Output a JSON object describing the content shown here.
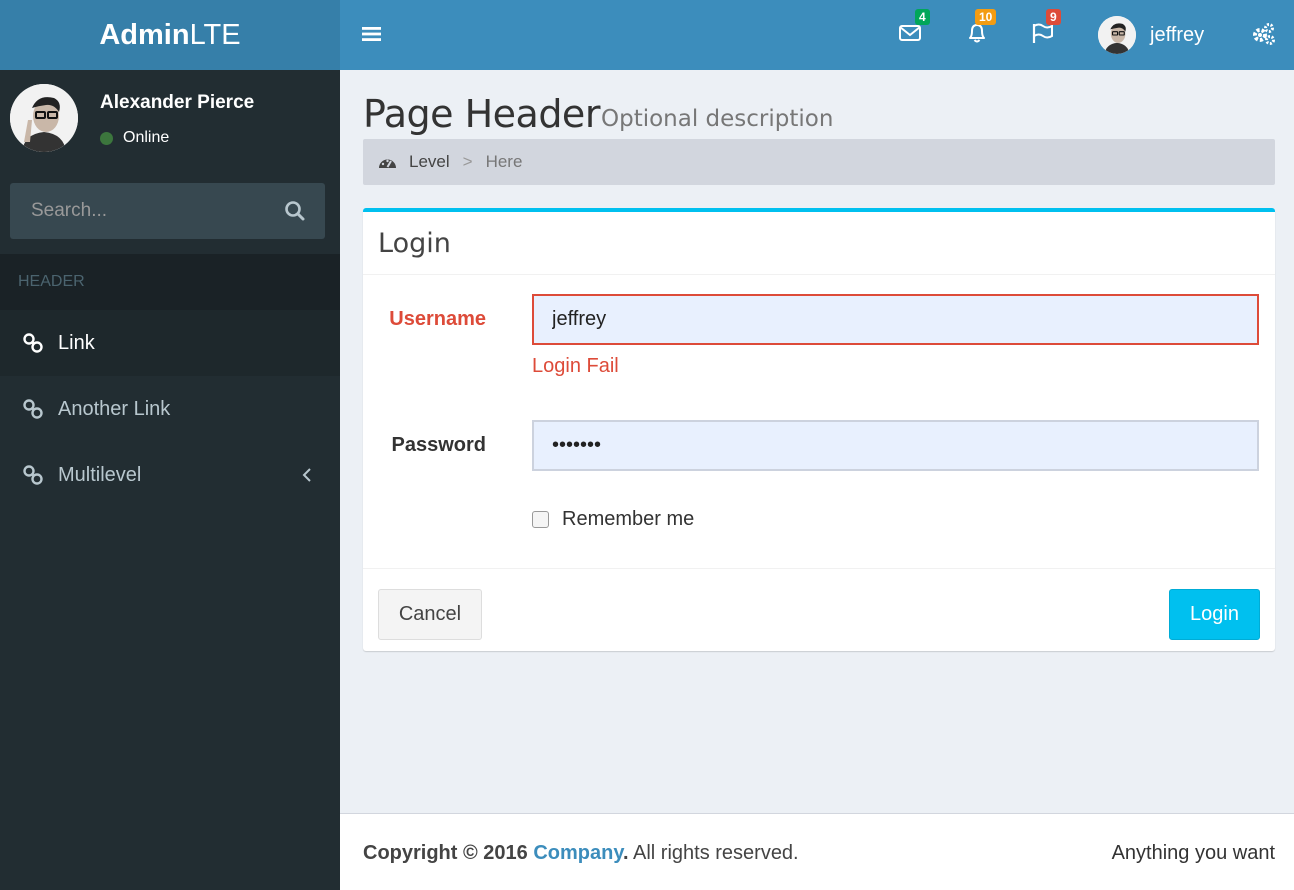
{
  "logo": {
    "bold": "Admin",
    "light": "LTE"
  },
  "sidebar": {
    "user_name": "Alexander Pierce",
    "user_status": "Online",
    "search_placeholder": "Search...",
    "header": "HEADER",
    "items": [
      {
        "label": "Link",
        "active": true
      },
      {
        "label": "Another Link",
        "active": false
      },
      {
        "label": "Multilevel",
        "active": false
      }
    ]
  },
  "navbar": {
    "messages_count": "4",
    "notifications_count": "10",
    "tasks_count": "9",
    "username": "jeffrey"
  },
  "colors": {
    "messages_badge": "#00a65a",
    "notifications_badge": "#f39c12",
    "tasks_badge": "#dd4b39"
  },
  "content": {
    "title": "Page Header",
    "description": "Optional description",
    "breadcrumb": {
      "level": "Level",
      "separator": ">",
      "here": "Here"
    }
  },
  "login_box": {
    "title": "Login",
    "username_label": "Username",
    "username_value": "jeffrey",
    "error": "Login Fail",
    "password_label": "Password",
    "password_value": "1234567",
    "remember_label": "Remember me",
    "cancel_label": "Cancel",
    "login_label": "Login"
  },
  "footer": {
    "copyright": "Copyright © 2016",
    "company": "Company",
    "rights": "All rights reserved.",
    "right_text": "Anything you want"
  }
}
